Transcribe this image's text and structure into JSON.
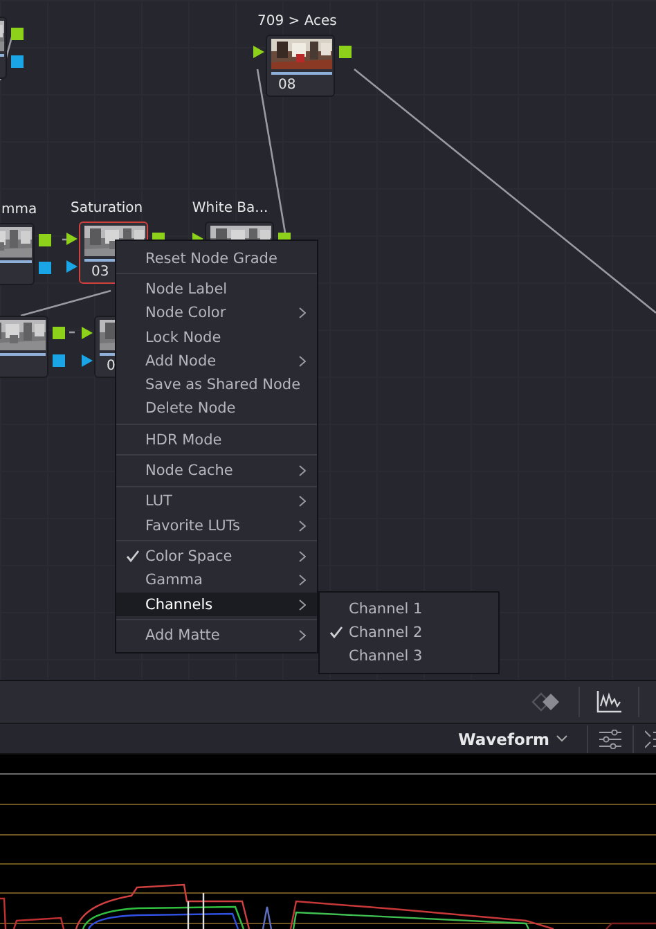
{
  "nodes": [
    {
      "selected": false
    },
    {
      "label": "709 > Aces",
      "number": "08",
      "selected": false
    },
    {
      "label": "mma",
      "selected": false
    },
    {
      "label": "Saturation",
      "number": "03",
      "selected": true
    },
    {
      "label": "White Ba...",
      "selected": false
    },
    {
      "selected": false
    },
    {
      "number": "0",
      "selected": false
    }
  ],
  "context_menu": {
    "sections": [
      [
        {
          "label": "Reset Node Grade",
          "checked": false,
          "submenu": false,
          "selected": false
        }
      ],
      [
        {
          "label": "Node Label",
          "checked": false,
          "submenu": false,
          "selected": false
        },
        {
          "label": "Node Color",
          "checked": false,
          "submenu": true,
          "selected": false
        },
        {
          "label": "Lock Node",
          "checked": false,
          "submenu": false,
          "selected": false
        },
        {
          "label": "Add Node",
          "checked": false,
          "submenu": true,
          "selected": false
        },
        {
          "label": "Save as Shared Node",
          "checked": false,
          "submenu": false,
          "selected": false
        },
        {
          "label": "Delete Node",
          "checked": false,
          "submenu": false,
          "selected": false
        }
      ],
      [
        {
          "label": "HDR Mode",
          "checked": false,
          "submenu": false,
          "selected": false
        }
      ],
      [
        {
          "label": "Node Cache",
          "checked": false,
          "submenu": true,
          "selected": false
        }
      ],
      [
        {
          "label": "LUT",
          "checked": false,
          "submenu": true,
          "selected": false
        },
        {
          "label": "Favorite LUTs",
          "checked": false,
          "submenu": true,
          "selected": false
        }
      ],
      [
        {
          "label": "Color Space",
          "checked": true,
          "submenu": true,
          "selected": false
        },
        {
          "label": "Gamma",
          "checked": false,
          "submenu": true,
          "selected": false
        },
        {
          "label": "Channels",
          "checked": false,
          "submenu": true,
          "selected": true
        }
      ],
      [
        {
          "label": "Add Matte",
          "checked": false,
          "submenu": true,
          "selected": false
        }
      ]
    ]
  },
  "submenu": {
    "items": [
      {
        "label": "Channel 1",
        "checked": false
      },
      {
        "label": "Channel 2",
        "checked": true
      },
      {
        "label": "Channel 3",
        "checked": false
      }
    ]
  },
  "scope": {
    "mode": "Waveform"
  }
}
